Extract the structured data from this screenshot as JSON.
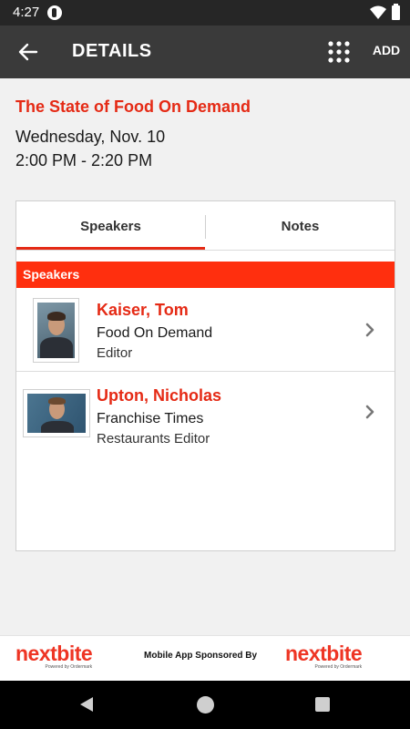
{
  "status_bar": {
    "time": "4:27"
  },
  "app_bar": {
    "title": "DETAILS",
    "add_label": "ADD"
  },
  "session": {
    "title": "The State of Food On Demand",
    "date": "Wednesday, Nov. 10",
    "time": "2:00 PM - 2:20 PM"
  },
  "tabs": [
    {
      "label": "Speakers",
      "selected": true
    },
    {
      "label": "Notes",
      "selected": false
    }
  ],
  "speakers_section": {
    "header": "Speakers",
    "items": [
      {
        "name": "Kaiser, Tom",
        "company": "Food On Demand",
        "role": "Editor"
      },
      {
        "name": "Upton, Nicholas",
        "company": "Franchise Times",
        "role": "Restaurants Editor"
      }
    ]
  },
  "footer": {
    "brand": "nextbite",
    "brand_tagline": "Powered by Ordermark",
    "sponsor_text": "Mobile App Sponsored By"
  },
  "colors": {
    "accent": "#e52a15",
    "section_header": "#ff2f0e",
    "app_bar": "#3a3a3a",
    "status_bar": "#262626"
  },
  "icons": {
    "back": "arrow-left-icon",
    "grid": "grid-icon",
    "chevron": "chevron-right-icon",
    "nav_back": "triangle-back-icon",
    "nav_home": "circle-home-icon",
    "nav_recents": "square-recents-icon"
  }
}
